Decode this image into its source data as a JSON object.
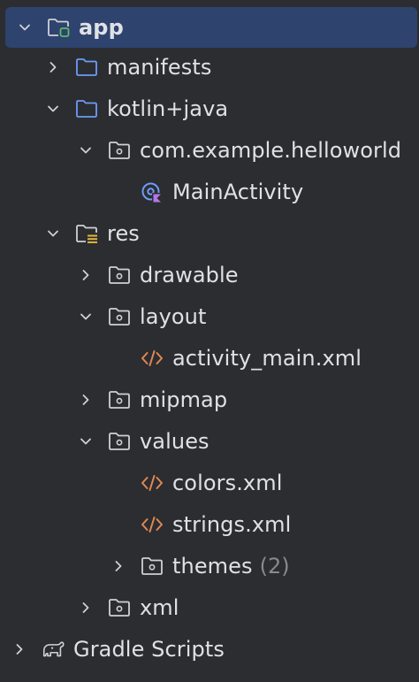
{
  "project_tree": {
    "app": {
      "label": "app",
      "chevron": "chevron-down",
      "icon": "module-folder-icon"
    },
    "manifests": {
      "label": "manifests",
      "chevron": "chevron-right",
      "icon": "folder-icon"
    },
    "kotlin_java": {
      "label": "kotlin+java",
      "chevron": "chevron-down",
      "icon": "folder-icon"
    },
    "package": {
      "label": "com.example.helloworld",
      "chevron": "chevron-down",
      "icon": "package-icon"
    },
    "main_activity": {
      "label": "MainActivity",
      "icon": "kotlin-class-icon"
    },
    "res": {
      "label": "res",
      "chevron": "chevron-down",
      "icon": "resources-folder-icon"
    },
    "drawable": {
      "label": "drawable",
      "chevron": "chevron-right",
      "icon": "package-icon"
    },
    "layout": {
      "label": "layout",
      "chevron": "chevron-down",
      "icon": "package-icon"
    },
    "activity_main": {
      "label": "activity_main.xml",
      "icon": "xml-file-icon"
    },
    "mipmap": {
      "label": "mipmap",
      "chevron": "chevron-right",
      "icon": "package-icon"
    },
    "values": {
      "label": "values",
      "chevron": "chevron-down",
      "icon": "package-icon"
    },
    "colors": {
      "label": "colors.xml",
      "icon": "xml-file-icon"
    },
    "strings": {
      "label": "strings.xml",
      "icon": "xml-file-icon"
    },
    "themes": {
      "label": "themes",
      "count": "(2)",
      "chevron": "chevron-right",
      "icon": "package-icon"
    },
    "xml": {
      "label": "xml",
      "chevron": "chevron-right",
      "icon": "package-icon"
    },
    "gradle_scripts": {
      "label": "Gradle Scripts",
      "chevron": "chevron-right",
      "icon": "gradle-elephant-icon"
    }
  },
  "colors": {
    "background": "#2b2d30",
    "selection": "#2e436e",
    "text": "#dfe1e5",
    "muted_text": "#868a91",
    "folder_blue": "#6d9bf8",
    "xml_orange": "#e08855",
    "module_green": "#5fb865"
  }
}
